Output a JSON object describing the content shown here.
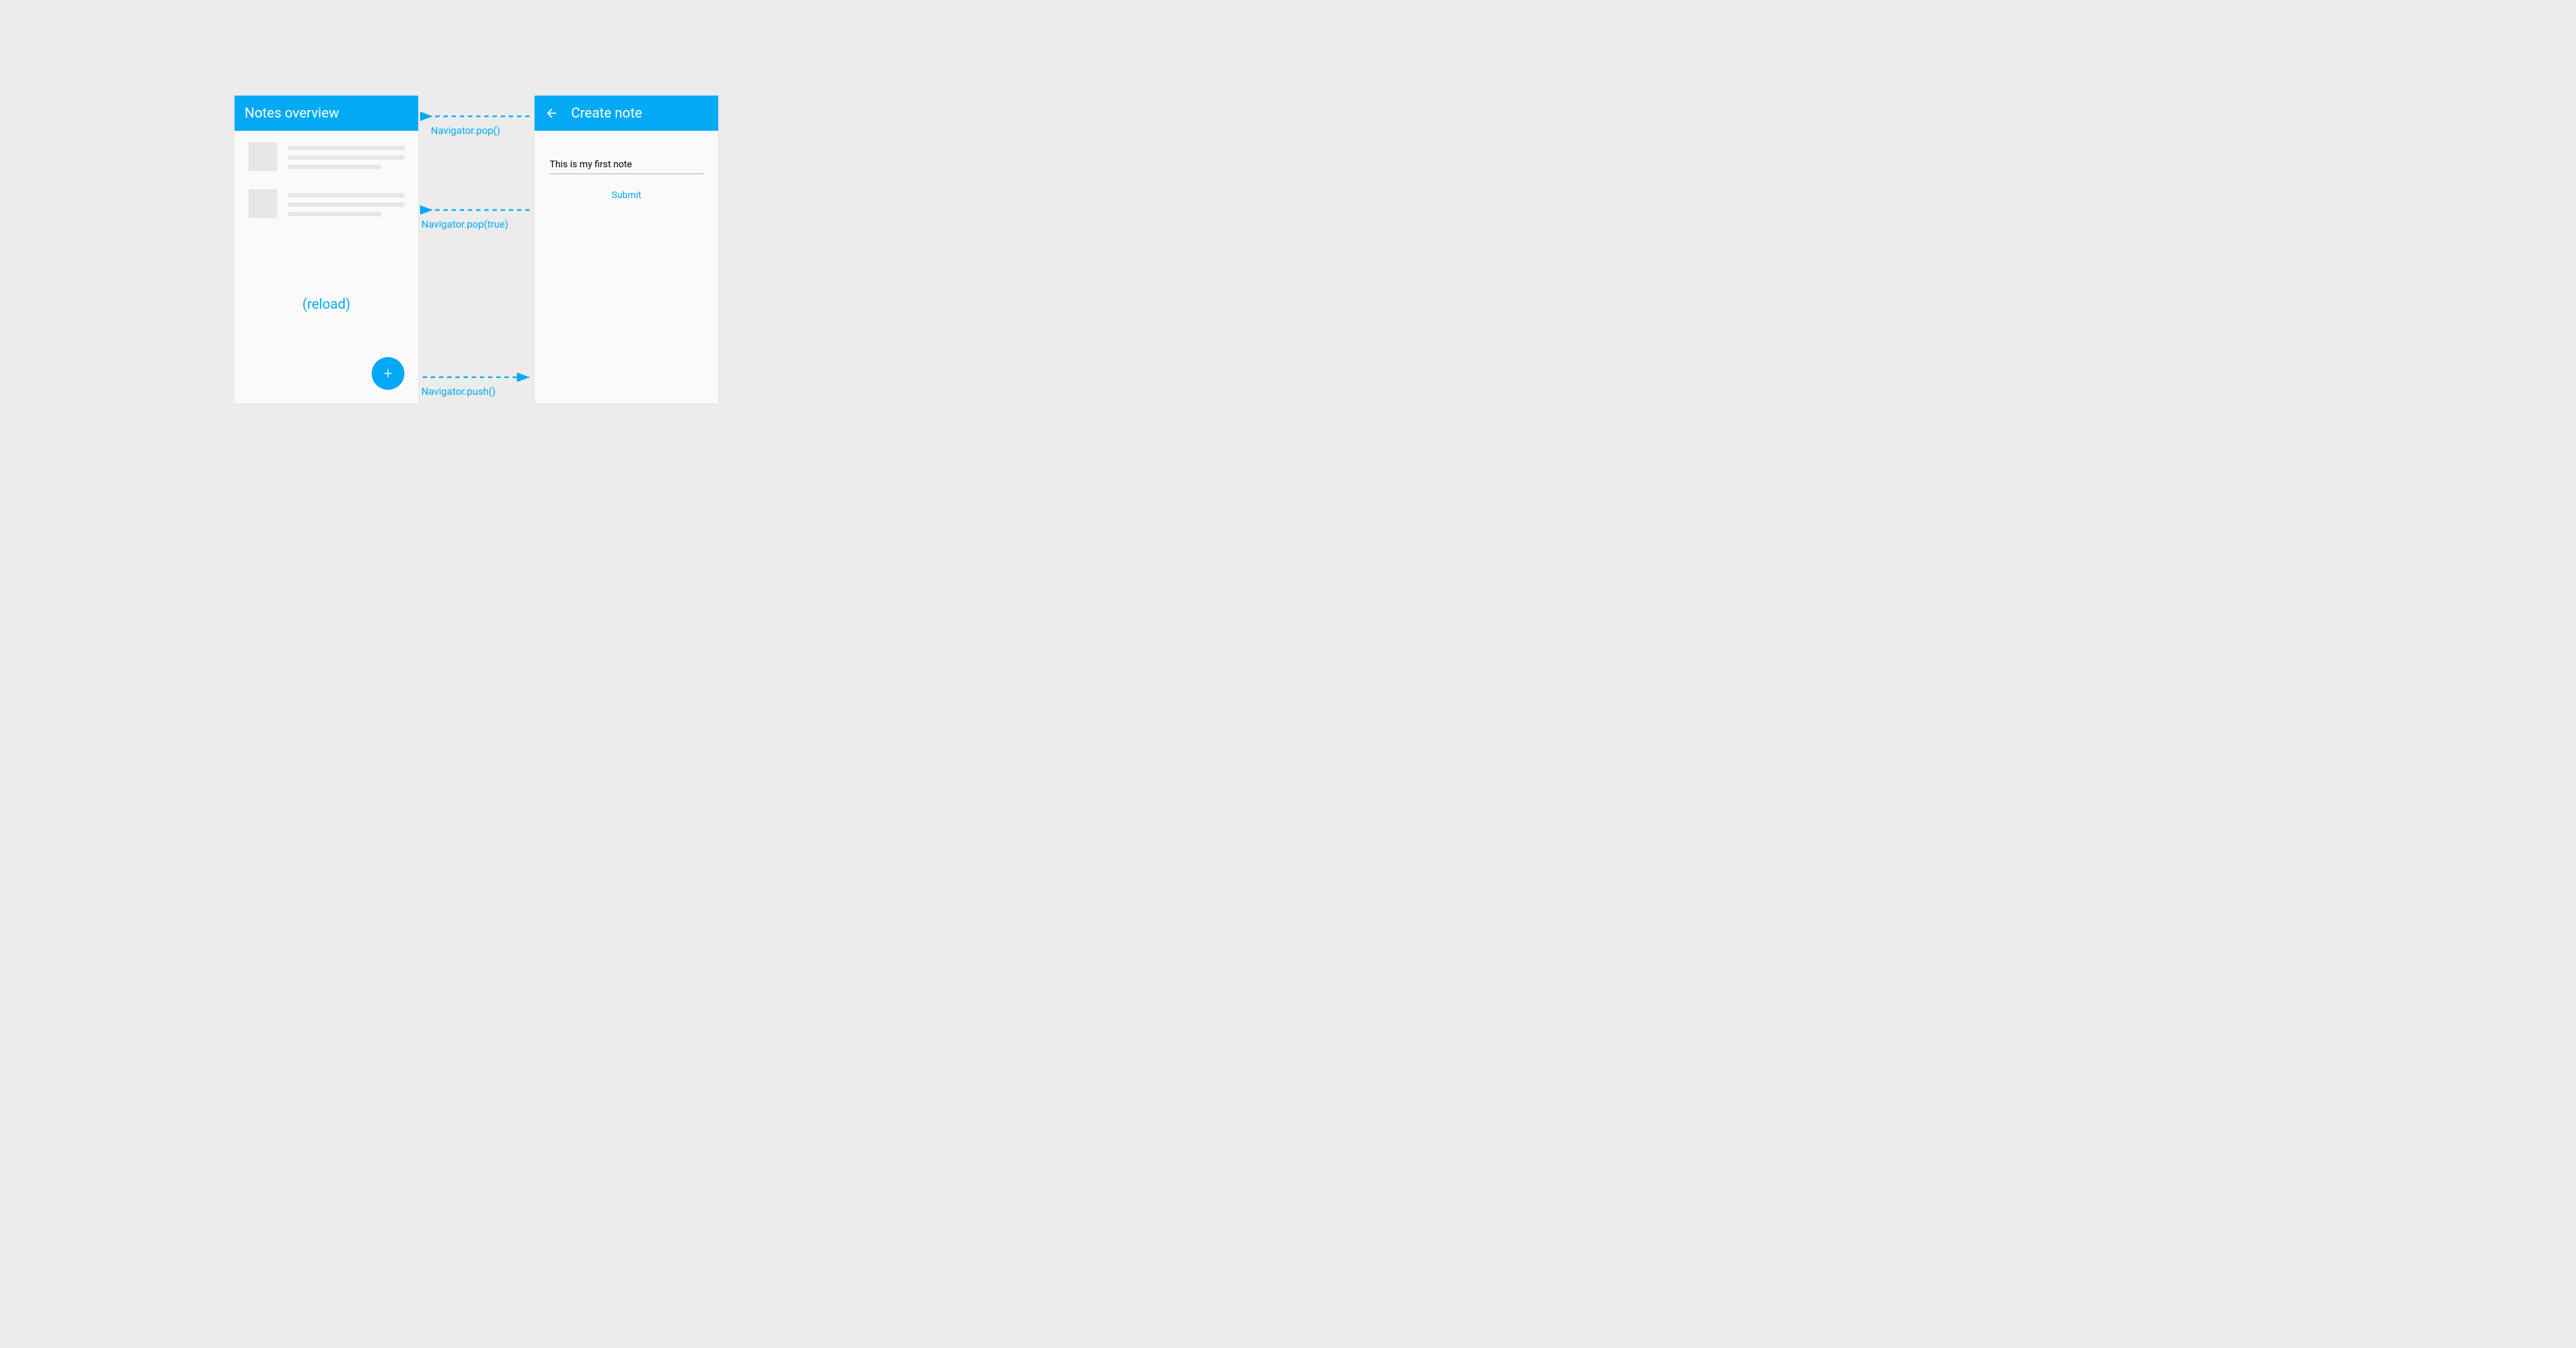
{
  "colors": {
    "accent": "#03a9f4",
    "bg": "#ececec",
    "panel": "#fafafa",
    "skeleton": "#e6e6e6"
  },
  "screens": {
    "overview": {
      "title": "Notes overview",
      "reload_label": "(reload)",
      "fab_label": "+"
    },
    "create": {
      "title": "Create note",
      "input_value": "This is my first note",
      "submit_label": "Submit"
    }
  },
  "arrows": {
    "pop": "Navigator.pop()",
    "pop_true": "Navigator.pop(true)",
    "push": "Navigator.push()"
  }
}
